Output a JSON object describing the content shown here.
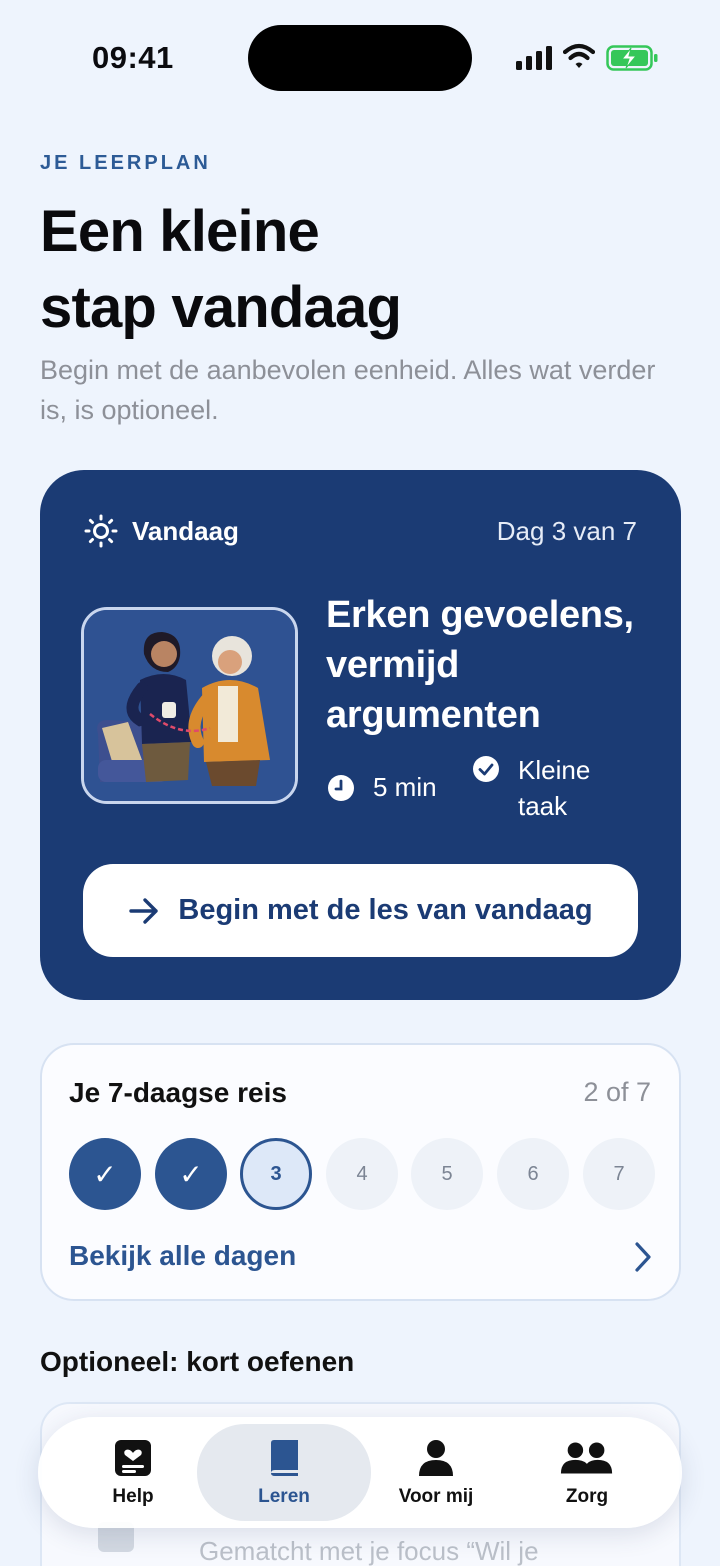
{
  "status": {
    "time": "09:41"
  },
  "header": {
    "eyebrow": "JE LEERPLAN",
    "title_line1": "Een kleine",
    "title_line2": "stap vandaag",
    "subtitle": "Begin met de aanbevolen eenheid. Alles wat verder is, is optioneel."
  },
  "today_card": {
    "label": "Vandaag",
    "day": "Dag 3 van 7",
    "title": "Erken gevoelens, vermijd argumenten",
    "duration": "5 min",
    "task_type": "Kleine taak",
    "cta": "Begin met de les van vandaag",
    "background_color": "#1b3b74"
  },
  "journey": {
    "title": "Je 7-daagse reis",
    "progress": "2 of 7",
    "days": [
      "✓",
      "✓",
      "3",
      "4",
      "5",
      "6",
      "7"
    ],
    "view_all": "Bekijk alle dagen"
  },
  "optional": {
    "heading": "Optioneel: kort oefenen",
    "card_subtitle": "Gematcht met je focus “Wil je"
  },
  "tabbar": {
    "help": "Help",
    "learn": "Leren",
    "me": "Voor mij",
    "care": "Zorg"
  },
  "colors": {
    "accent": "#2c5591",
    "background": "#eef4fd"
  }
}
